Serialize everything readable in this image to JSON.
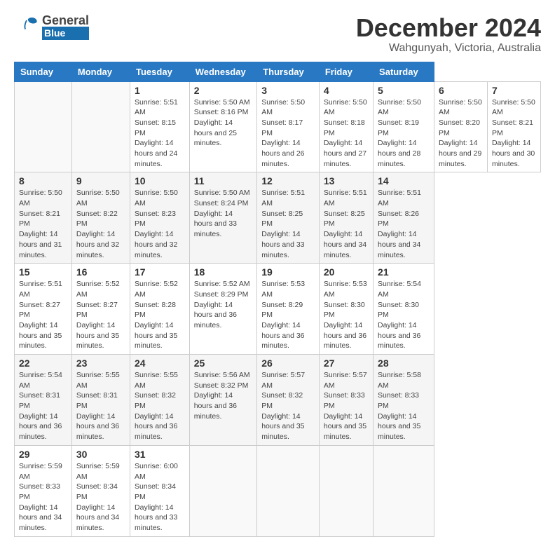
{
  "header": {
    "logo_general": "General",
    "logo_blue": "Blue",
    "month_title": "December 2024",
    "location": "Wahgunyah, Victoria, Australia"
  },
  "calendar": {
    "headers": [
      "Sunday",
      "Monday",
      "Tuesday",
      "Wednesday",
      "Thursday",
      "Friday",
      "Saturday"
    ],
    "weeks": [
      [
        null,
        null,
        {
          "day": "1",
          "sunrise": "Sunrise: 5:51 AM",
          "sunset": "Sunset: 8:15 PM",
          "daylight": "Daylight: 14 hours and 24 minutes."
        },
        {
          "day": "2",
          "sunrise": "Sunrise: 5:50 AM",
          "sunset": "Sunset: 8:16 PM",
          "daylight": "Daylight: 14 hours and 25 minutes."
        },
        {
          "day": "3",
          "sunrise": "Sunrise: 5:50 AM",
          "sunset": "Sunset: 8:17 PM",
          "daylight": "Daylight: 14 hours and 26 minutes."
        },
        {
          "day": "4",
          "sunrise": "Sunrise: 5:50 AM",
          "sunset": "Sunset: 8:18 PM",
          "daylight": "Daylight: 14 hours and 27 minutes."
        },
        {
          "day": "5",
          "sunrise": "Sunrise: 5:50 AM",
          "sunset": "Sunset: 8:19 PM",
          "daylight": "Daylight: 14 hours and 28 minutes."
        },
        {
          "day": "6",
          "sunrise": "Sunrise: 5:50 AM",
          "sunset": "Sunset: 8:20 PM",
          "daylight": "Daylight: 14 hours and 29 minutes."
        },
        {
          "day": "7",
          "sunrise": "Sunrise: 5:50 AM",
          "sunset": "Sunset: 8:21 PM",
          "daylight": "Daylight: 14 hours and 30 minutes."
        }
      ],
      [
        {
          "day": "8",
          "sunrise": "Sunrise: 5:50 AM",
          "sunset": "Sunset: 8:21 PM",
          "daylight": "Daylight: 14 hours and 31 minutes."
        },
        {
          "day": "9",
          "sunrise": "Sunrise: 5:50 AM",
          "sunset": "Sunset: 8:22 PM",
          "daylight": "Daylight: 14 hours and 32 minutes."
        },
        {
          "day": "10",
          "sunrise": "Sunrise: 5:50 AM",
          "sunset": "Sunset: 8:23 PM",
          "daylight": "Daylight: 14 hours and 32 minutes."
        },
        {
          "day": "11",
          "sunrise": "Sunrise: 5:50 AM",
          "sunset": "Sunset: 8:24 PM",
          "daylight": "Daylight: 14 hours and 33 minutes."
        },
        {
          "day": "12",
          "sunrise": "Sunrise: 5:51 AM",
          "sunset": "Sunset: 8:25 PM",
          "daylight": "Daylight: 14 hours and 33 minutes."
        },
        {
          "day": "13",
          "sunrise": "Sunrise: 5:51 AM",
          "sunset": "Sunset: 8:25 PM",
          "daylight": "Daylight: 14 hours and 34 minutes."
        },
        {
          "day": "14",
          "sunrise": "Sunrise: 5:51 AM",
          "sunset": "Sunset: 8:26 PM",
          "daylight": "Daylight: 14 hours and 34 minutes."
        }
      ],
      [
        {
          "day": "15",
          "sunrise": "Sunrise: 5:51 AM",
          "sunset": "Sunset: 8:27 PM",
          "daylight": "Daylight: 14 hours and 35 minutes."
        },
        {
          "day": "16",
          "sunrise": "Sunrise: 5:52 AM",
          "sunset": "Sunset: 8:27 PM",
          "daylight": "Daylight: 14 hours and 35 minutes."
        },
        {
          "day": "17",
          "sunrise": "Sunrise: 5:52 AM",
          "sunset": "Sunset: 8:28 PM",
          "daylight": "Daylight: 14 hours and 35 minutes."
        },
        {
          "day": "18",
          "sunrise": "Sunrise: 5:52 AM",
          "sunset": "Sunset: 8:29 PM",
          "daylight": "Daylight: 14 hours and 36 minutes."
        },
        {
          "day": "19",
          "sunrise": "Sunrise: 5:53 AM",
          "sunset": "Sunset: 8:29 PM",
          "daylight": "Daylight: 14 hours and 36 minutes."
        },
        {
          "day": "20",
          "sunrise": "Sunrise: 5:53 AM",
          "sunset": "Sunset: 8:30 PM",
          "daylight": "Daylight: 14 hours and 36 minutes."
        },
        {
          "day": "21",
          "sunrise": "Sunrise: 5:54 AM",
          "sunset": "Sunset: 8:30 PM",
          "daylight": "Daylight: 14 hours and 36 minutes."
        }
      ],
      [
        {
          "day": "22",
          "sunrise": "Sunrise: 5:54 AM",
          "sunset": "Sunset: 8:31 PM",
          "daylight": "Daylight: 14 hours and 36 minutes."
        },
        {
          "day": "23",
          "sunrise": "Sunrise: 5:55 AM",
          "sunset": "Sunset: 8:31 PM",
          "daylight": "Daylight: 14 hours and 36 minutes."
        },
        {
          "day": "24",
          "sunrise": "Sunrise: 5:55 AM",
          "sunset": "Sunset: 8:32 PM",
          "daylight": "Daylight: 14 hours and 36 minutes."
        },
        {
          "day": "25",
          "sunrise": "Sunrise: 5:56 AM",
          "sunset": "Sunset: 8:32 PM",
          "daylight": "Daylight: 14 hours and 36 minutes."
        },
        {
          "day": "26",
          "sunrise": "Sunrise: 5:57 AM",
          "sunset": "Sunset: 8:32 PM",
          "daylight": "Daylight: 14 hours and 35 minutes."
        },
        {
          "day": "27",
          "sunrise": "Sunrise: 5:57 AM",
          "sunset": "Sunset: 8:33 PM",
          "daylight": "Daylight: 14 hours and 35 minutes."
        },
        {
          "day": "28",
          "sunrise": "Sunrise: 5:58 AM",
          "sunset": "Sunset: 8:33 PM",
          "daylight": "Daylight: 14 hours and 35 minutes."
        }
      ],
      [
        {
          "day": "29",
          "sunrise": "Sunrise: 5:59 AM",
          "sunset": "Sunset: 8:33 PM",
          "daylight": "Daylight: 14 hours and 34 minutes."
        },
        {
          "day": "30",
          "sunrise": "Sunrise: 5:59 AM",
          "sunset": "Sunset: 8:34 PM",
          "daylight": "Daylight: 14 hours and 34 minutes."
        },
        {
          "day": "31",
          "sunrise": "Sunrise: 6:00 AM",
          "sunset": "Sunset: 8:34 PM",
          "daylight": "Daylight: 14 hours and 33 minutes."
        },
        null,
        null,
        null,
        null
      ]
    ]
  }
}
